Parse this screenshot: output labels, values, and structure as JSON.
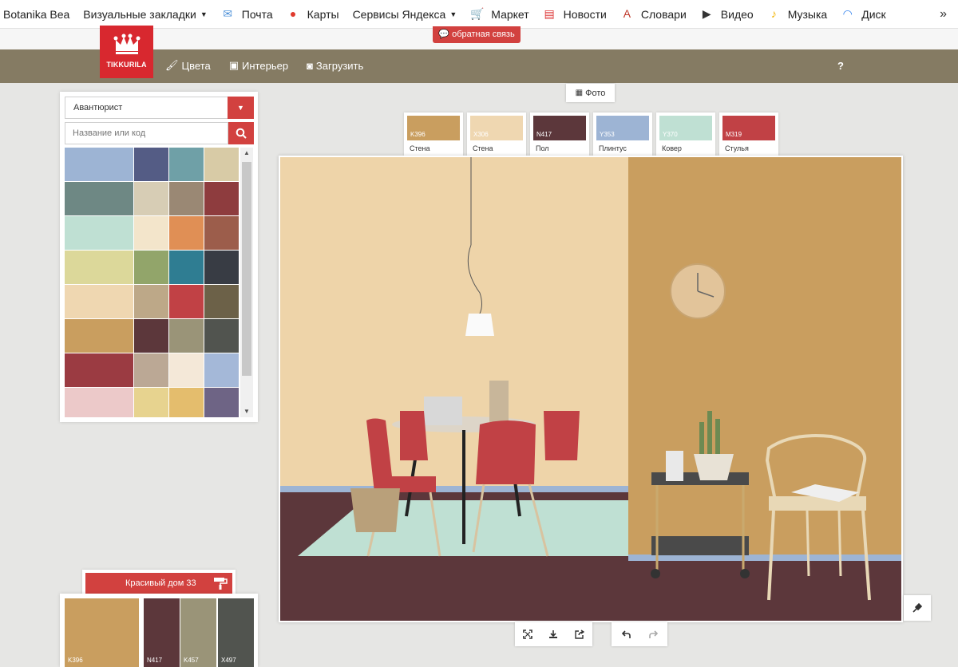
{
  "bookmarks": [
    {
      "label": "Botanika Bea",
      "icon": "none",
      "caret": false
    },
    {
      "label": "Визуальные закладки",
      "icon": "none",
      "caret": true
    },
    {
      "label": "Почта",
      "icon": "mail-icon",
      "color": "#4a8fd8",
      "caret": false
    },
    {
      "label": "Карты",
      "icon": "map-pin-icon",
      "color": "#e03a2d",
      "caret": false
    },
    {
      "label": "Сервисы Яндекса",
      "icon": "none",
      "caret": true
    },
    {
      "label": "Маркет",
      "icon": "cart-icon",
      "color": "#2b64c6",
      "caret": false
    },
    {
      "label": "Новости",
      "icon": "news-icon",
      "color": "#d33",
      "caret": false
    },
    {
      "label": "Словари",
      "icon": "dictionary-icon",
      "color": "#c0392b",
      "caret": false
    },
    {
      "label": "Видео",
      "icon": "video-icon",
      "color": "#333",
      "caret": false
    },
    {
      "label": "Музыка",
      "icon": "music-icon",
      "color": "#f2b300",
      "caret": false
    },
    {
      "label": "Диск",
      "icon": "disk-icon",
      "color": "#2f80ed",
      "caret": false
    }
  ],
  "feedback_label": "обратная связь",
  "logo_text": "TIKKURILA",
  "nav": [
    {
      "label": "Цвета",
      "icon": "paint-icon"
    },
    {
      "label": "Интерьер",
      "icon": "image-icon"
    },
    {
      "label": "Загрузить",
      "icon": "camera-icon"
    }
  ],
  "help_label": "?",
  "collection": {
    "selected": "Авантюрист"
  },
  "search": {
    "placeholder": "Название или код"
  },
  "palette_colors": [
    "#9db4d4",
    "#545c85",
    "#6fa0a7",
    "#d8cba6",
    "#6e8884",
    "#d7cdb5",
    "#9a8874",
    "#8e3c3e",
    "#bfe0d3",
    "#f3e5cb",
    "#e08f55",
    "#9c5d4b",
    "#dcd89a",
    "#92a56a",
    "#2f7d92",
    "#383c44",
    "#efd7b1",
    "#bda888",
    "#c14145",
    "#6c6148",
    "#c99e5f",
    "#5c373b",
    "#9a9478",
    "#51544f",
    "#9b3b42",
    "#bba895",
    "#f4e8d8",
    "#a4b8d8",
    "#ecc9c9",
    "#e7d38f",
    "#e4bd6d",
    "#6e6485"
  ],
  "scheme": {
    "name": "Красивый дом 33",
    "swatches": [
      {
        "code": "K396",
        "color": "#c99e5f"
      },
      {
        "code": "N417",
        "color": "#5c373b"
      },
      {
        "code": "K457",
        "color": "#9a9478"
      },
      {
        "code": "X497",
        "color": "#51544f"
      }
    ]
  },
  "photo_label": "Фото",
  "roles": [
    {
      "code": "K396",
      "label": "Стена",
      "color": "#c99e5f"
    },
    {
      "code": "X306",
      "label": "Стена",
      "color": "#efd7b1"
    },
    {
      "code": "N417",
      "label": "Пол",
      "color": "#5c373b"
    },
    {
      "code": "Y353",
      "label": "Плинтус",
      "color": "#9db4d4"
    },
    {
      "code": "Y370",
      "label": "Ковер",
      "color": "#bfe0d3"
    },
    {
      "code": "M319",
      "label": "Стулья",
      "color": "#c14145"
    }
  ],
  "colors": {
    "accent": "#d2413f",
    "header": "#857b63",
    "logo": "#d8282f"
  }
}
